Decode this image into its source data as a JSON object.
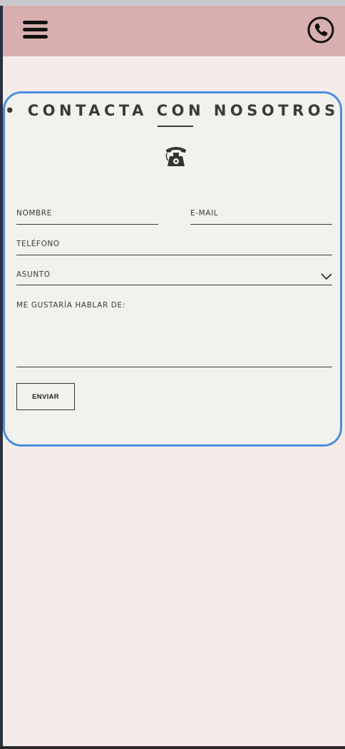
{
  "header": {
    "menu_icon": "hamburger-menu-icon",
    "call_icon": "phone-circle-icon",
    "background_color": "#d8afae"
  },
  "contact": {
    "title": "• CONTACTA CON NOSOTROS •",
    "decor_icon": "vintage-telephone-icon",
    "border_color": "#4a8fde",
    "fields": {
      "name_label": "NOMBRE",
      "email_label": "E-MAIL",
      "phone_label": "TELÉFONO",
      "subject_label": "ASUNTO",
      "message_label": "ME GUSTARÍA HABLAR DE:"
    },
    "send_label": "ENVIAR"
  }
}
